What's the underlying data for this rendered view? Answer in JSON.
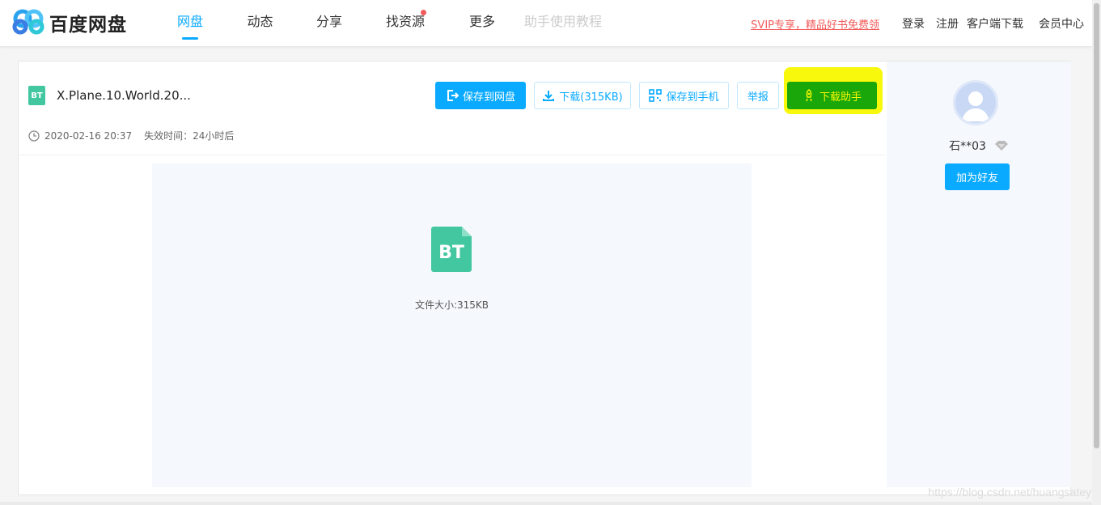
{
  "header": {
    "logo_text": "百度网盘",
    "nav": [
      {
        "label": "网盘",
        "active": true
      },
      {
        "label": "动态"
      },
      {
        "label": "分享"
      },
      {
        "label": "找资源",
        "has_dot": true
      },
      {
        "label": "更多"
      },
      {
        "label": "助手使用教程",
        "disabled": true
      }
    ],
    "svip_link": "SVIP专享，精品好书免费领",
    "login": "登录",
    "register": "注册",
    "client_download": "客户端下载",
    "member_center": "会员中心"
  },
  "file": {
    "type_label": "BT",
    "name": "X.Plane.10.World.20...",
    "date": "2020-02-16 20:37",
    "expire": "失效时间：24小时后",
    "size_text": "文件大小:315KB"
  },
  "actions": {
    "save_to_pan": "保存到网盘",
    "download": "下载(315KB)",
    "save_to_phone": "保存到手机",
    "report": "举报",
    "download_assistant": "下载助手"
  },
  "user": {
    "name": "石**03",
    "add_friend": "加为好友"
  },
  "watermark": "https://blog.csdn.net/huangsatey",
  "colors": {
    "brand": "#09aaff",
    "bt_green": "#43c7a1",
    "assistant_green": "#1aa70a",
    "highlight_yellow": "#f8f800",
    "svip_red": "#f25b5b"
  }
}
